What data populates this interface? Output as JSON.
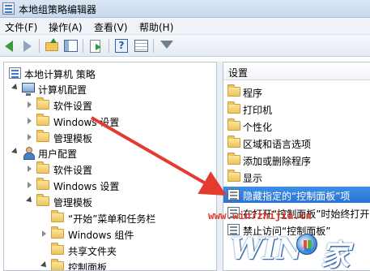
{
  "window": {
    "title": "本地组策略编辑器"
  },
  "menu": [
    {
      "label": "文件(F)"
    },
    {
      "label": "操作(A)"
    },
    {
      "label": "查看(V)"
    },
    {
      "label": "帮助(H)"
    }
  ],
  "toolbar": {
    "buttons": [
      {
        "icon": "back-arrow-icon"
      },
      {
        "icon": "forward-arrow-icon"
      },
      {
        "icon": "up-folder-icon"
      },
      {
        "icon": "show-hide-tree-icon"
      },
      {
        "icon": "export-list-icon"
      },
      {
        "icon": "help-icon"
      },
      {
        "icon": "properties-icon"
      },
      {
        "icon": "filter-icon"
      }
    ]
  },
  "tree": {
    "items": [
      {
        "label": "本地计算机 策略"
      },
      {
        "label": "计算机配置"
      },
      {
        "label": "软件设置"
      },
      {
        "label": "Windows 设置"
      },
      {
        "label": "管理模板"
      },
      {
        "label": "用户配置"
      },
      {
        "label": "软件设置"
      },
      {
        "label": "Windows 设置"
      },
      {
        "label": "管理模板"
      },
      {
        "label": "“开始”菜单和任务栏"
      },
      {
        "label": "Windows 组件"
      },
      {
        "label": "共享文件夹"
      },
      {
        "label": "控制面板"
      }
    ]
  },
  "list": {
    "header": "设置",
    "items": [
      {
        "label": "程序"
      },
      {
        "label": "打印机"
      },
      {
        "label": "个性化"
      },
      {
        "label": "区域和语言选项"
      },
      {
        "label": "添加或删除程序"
      },
      {
        "label": "显示"
      },
      {
        "label": "隐藏指定的“控制面板”项"
      },
      {
        "label": "在打开“控制面板”时始终打开"
      },
      {
        "label": "禁止访问“控制面板”"
      }
    ]
  },
  "watermark": {
    "url": "www.win7zhijia.cn",
    "logo_text": "WIN",
    "logo_suffix": "家"
  },
  "colors": {
    "selection": "#2a74d4",
    "annotation_arrow": "#e43a2f",
    "folder": "#eec35b"
  }
}
